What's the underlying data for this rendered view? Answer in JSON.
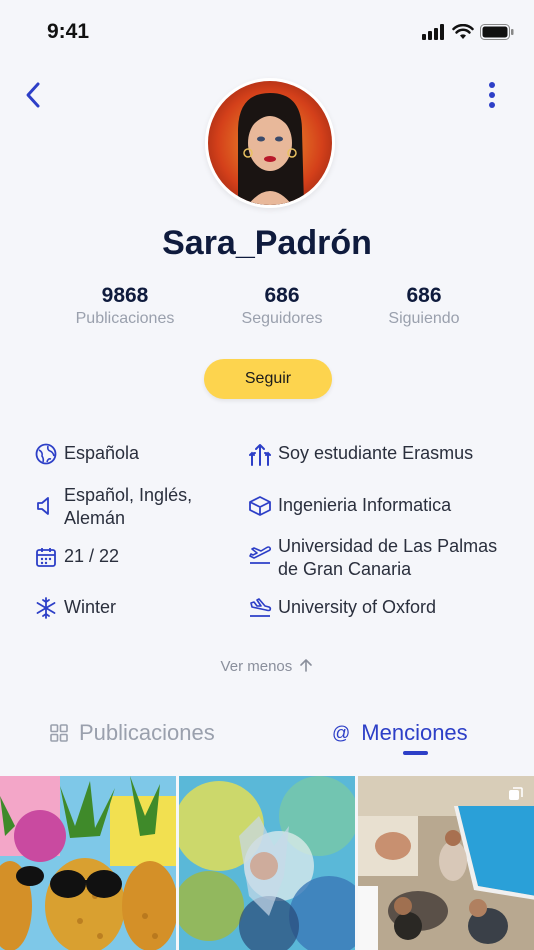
{
  "status": {
    "time": "9:41"
  },
  "profile": {
    "username": "Sara_Padrón",
    "stats": [
      {
        "value": "9868",
        "label": "Publicaciones"
      },
      {
        "value": "686",
        "label": "Seguidores"
      },
      {
        "value": "686",
        "label": "Siguiendo"
      }
    ],
    "follow_label": "Seguir"
  },
  "info": {
    "nationality": "Española",
    "erasmus": "Soy estudiante Erasmus",
    "languages": "Español, Inglés, Alemán",
    "degree": "Ingenieria Informatica",
    "course": "21 / 22",
    "origin_university": "Universidad de Las Palmas de Gran Canaria",
    "season": "Winter",
    "destination_university": "University of Oxford"
  },
  "see_less_label": "Ver menos",
  "tabs": {
    "publications": "Publicaciones",
    "mentions": "Menciones",
    "active": "mentions"
  },
  "colors": {
    "accent": "#2d3fc7",
    "follow_button": "#fdd44e",
    "text_primary": "#0f1b3d",
    "text_muted": "#9aa0ad"
  }
}
